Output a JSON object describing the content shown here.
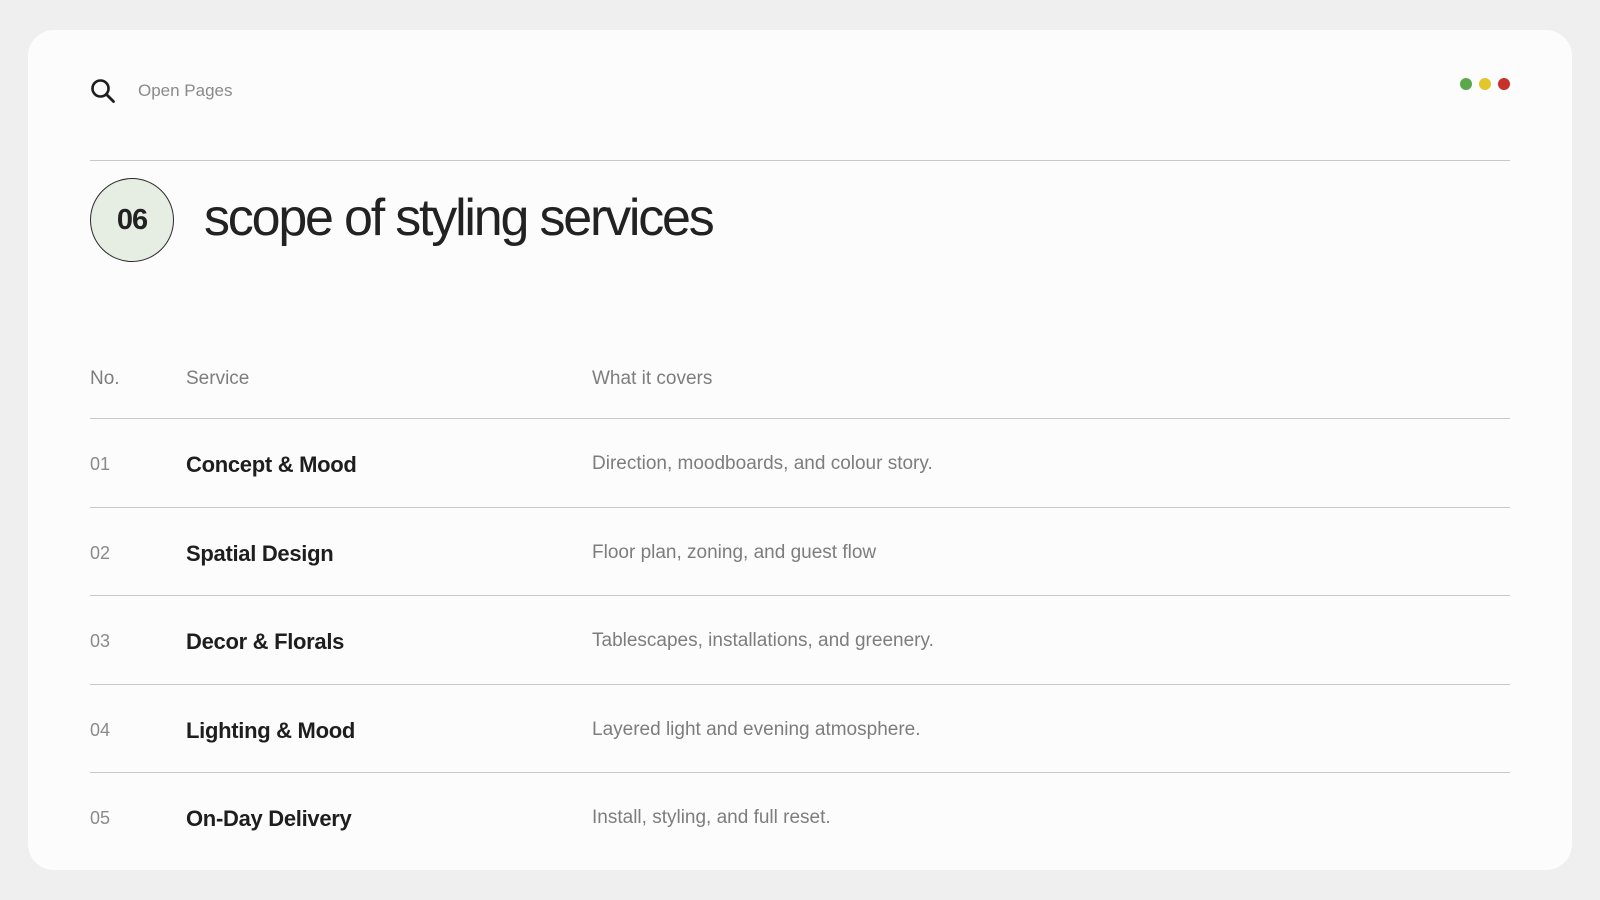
{
  "search": {
    "label": "Open Pages",
    "icon": "search-icon"
  },
  "window_controls": [
    {
      "name": "green-dot",
      "color": "#5aa84a"
    },
    {
      "name": "yellow-dot",
      "color": "#e2c72c"
    },
    {
      "name": "red-dot",
      "color": "#c8302a"
    }
  ],
  "header": {
    "badge": "06",
    "title": "scope of styling services"
  },
  "table": {
    "columns": {
      "no": "No.",
      "service": "Service",
      "covers": "What it covers"
    },
    "rows": [
      {
        "no": "01",
        "service": "Concept & Mood",
        "covers": "Direction, moodboards, and colour story."
      },
      {
        "no": "02",
        "service": "Spatial Design",
        "covers": "Floor plan, zoning, and guest flow"
      },
      {
        "no": "03",
        "service": "Decor & Florals",
        "covers": "Tablescapes, installations, and greenery."
      },
      {
        "no": "04",
        "service": "Lighting & Mood",
        "covers": "Layered light and evening atmosphere."
      },
      {
        "no": "05",
        "service": "On-Day Delivery",
        "covers": "Install, styling, and full reset."
      }
    ]
  },
  "colors": {
    "badge_fill": "#e6ede3",
    "text_primary": "#1e1e1e",
    "text_muted": "#7d7d7d"
  }
}
